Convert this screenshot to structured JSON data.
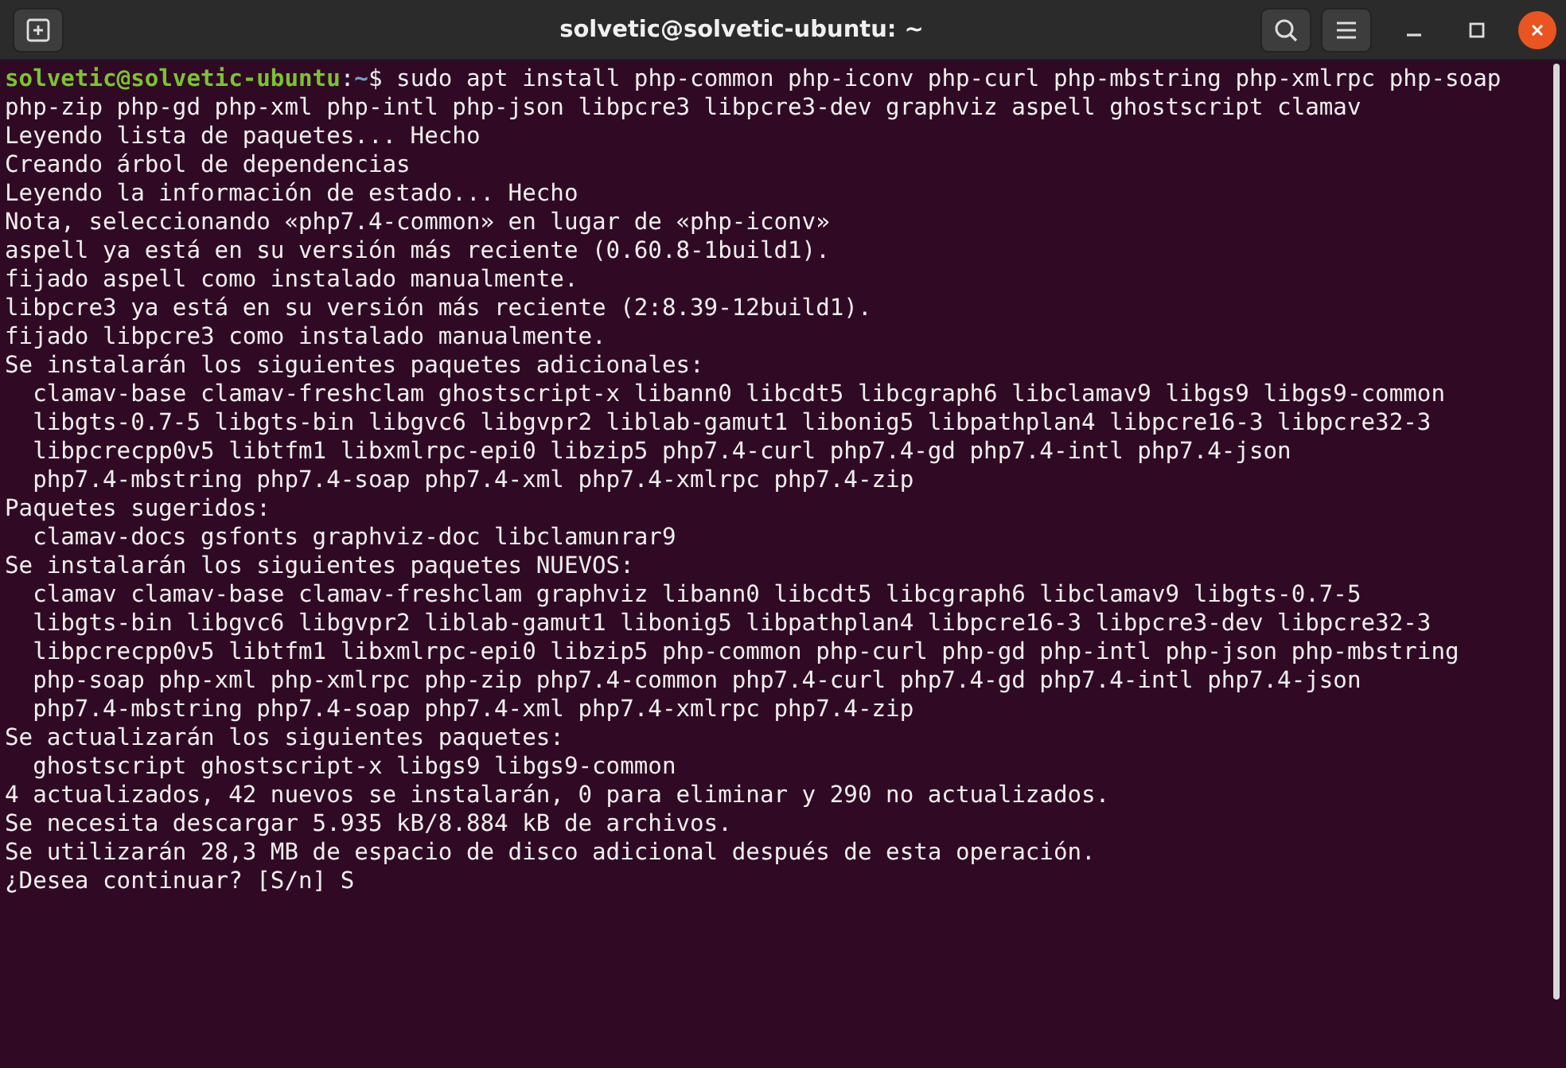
{
  "window": {
    "title": "solvetic@solvetic-ubuntu: ~"
  },
  "terminal": {
    "prompt": {
      "user_host": "solvetic@solvetic-ubuntu",
      "separator": ":",
      "path": "~",
      "symbol": "$",
      "command": "sudo apt install php-common php-iconv php-curl php-mbstring php-xmlrpc php-soap"
    },
    "lines": [
      "php-zip php-gd php-xml php-intl php-json libpcre3 libpcre3-dev graphviz aspell ghostscript clamav",
      "Leyendo lista de paquetes... Hecho",
      "Creando árbol de dependencias",
      "Leyendo la información de estado... Hecho",
      "Nota, seleccionando «php7.4-common» en lugar de «php-iconv»",
      "aspell ya está en su versión más reciente (0.60.8-1build1).",
      "fijado aspell como instalado manualmente.",
      "libpcre3 ya está en su versión más reciente (2:8.39-12build1).",
      "fijado libpcre3 como instalado manualmente.",
      "Se instalarán los siguientes paquetes adicionales:",
      "  clamav-base clamav-freshclam ghostscript-x libann0 libcdt5 libcgraph6 libclamav9 libgs9 libgs9-common",
      "  libgts-0.7-5 libgts-bin libgvc6 libgvpr2 liblab-gamut1 libonig5 libpathplan4 libpcre16-3 libpcre32-3",
      "  libpcrecpp0v5 libtfm1 libxmlrpc-epi0 libzip5 php7.4-curl php7.4-gd php7.4-intl php7.4-json",
      "  php7.4-mbstring php7.4-soap php7.4-xml php7.4-xmlrpc php7.4-zip",
      "Paquetes sugeridos:",
      "  clamav-docs gsfonts graphviz-doc libclamunrar9",
      "Se instalarán los siguientes paquetes NUEVOS:",
      "  clamav clamav-base clamav-freshclam graphviz libann0 libcdt5 libcgraph6 libclamav9 libgts-0.7-5",
      "  libgts-bin libgvc6 libgvpr2 liblab-gamut1 libonig5 libpathplan4 libpcre16-3 libpcre3-dev libpcre32-3",
      "  libpcrecpp0v5 libtfm1 libxmlrpc-epi0 libzip5 php-common php-curl php-gd php-intl php-json php-mbstring",
      "  php-soap php-xml php-xmlrpc php-zip php7.4-common php7.4-curl php7.4-gd php7.4-intl php7.4-json",
      "  php7.4-mbstring php7.4-soap php7.4-xml php7.4-xmlrpc php7.4-zip",
      "Se actualizarán los siguientes paquetes:",
      "  ghostscript ghostscript-x libgs9 libgs9-common",
      "4 actualizados, 42 nuevos se instalarán, 0 para eliminar y 290 no actualizados.",
      "Se necesita descargar 5.935 kB/8.884 kB de archivos.",
      "Se utilizarán 28,3 MB de espacio de disco adicional después de esta operación.",
      "¿Desea continuar? [S/n] S"
    ]
  }
}
